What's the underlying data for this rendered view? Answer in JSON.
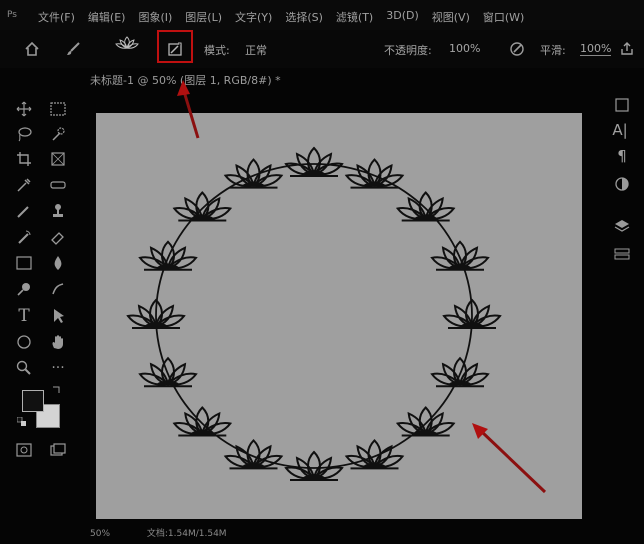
{
  "app": {
    "logo": "Ps"
  },
  "menu": [
    "文件(F)",
    "编辑(E)",
    "图象(I)",
    "图层(L)",
    "文字(Y)",
    "选择(S)",
    "滤镜(T)",
    "3D(D)",
    "视图(V)",
    "窗口(W)"
  ],
  "options": {
    "mode_label": "模式:",
    "mode_value": "正常",
    "opacity_label": "不透明度:",
    "opacity_value": "100%",
    "smoothing_label": "平滑:",
    "smoothing_value": "100%"
  },
  "document": {
    "tab_title": "未标题-1 @ 50% (图层 1, RGB/8#) *"
  },
  "status": {
    "zoom": "50%",
    "doc_info": "文档:1.54M/1.54M"
  },
  "colors": {
    "foreground": "#111111",
    "background": "#d4d4d4",
    "canvas": "#9f9f9f",
    "accent": "#c01010"
  }
}
